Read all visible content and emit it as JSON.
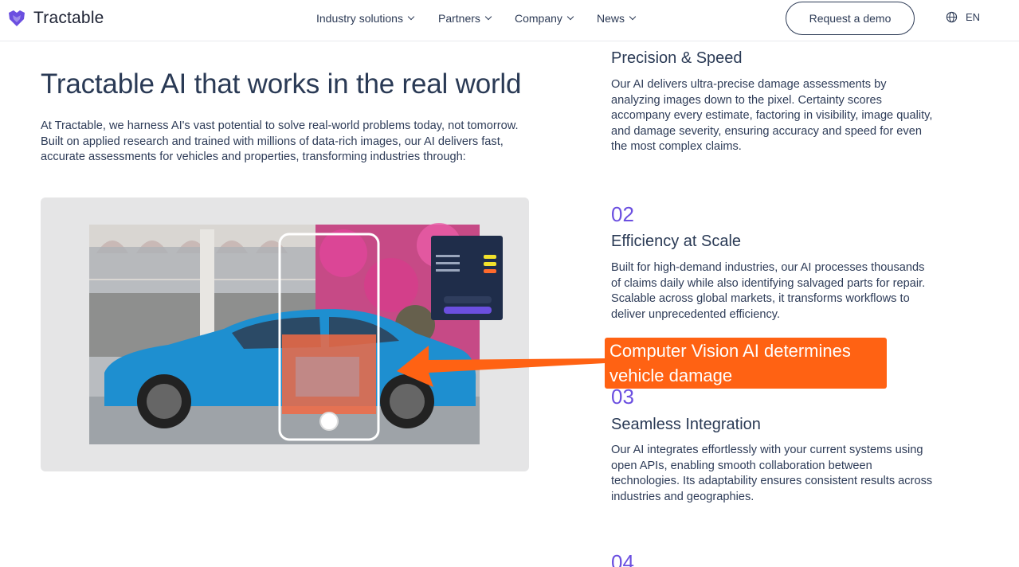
{
  "header": {
    "brand": "Tractable",
    "nav": [
      {
        "label": "Industry solutions"
      },
      {
        "label": "Partners"
      },
      {
        "label": "Company"
      },
      {
        "label": "News"
      }
    ],
    "cta_label": "Request a demo",
    "language": "EN"
  },
  "hero": {
    "title": "Tractable AI that works in the real world",
    "body": "At Tractable, we harness AI's vast potential to solve real-world problems today, not tomorrow. Built on applied research and trained with millions of data-rich images, our AI delivers fast, accurate assessments for vehicles and properties, transforming industries through:"
  },
  "features": [
    {
      "title": "Precision & Speed",
      "body": "Our AI delivers ultra-precise damage assessments by analyzing images down to the pixel. Certainty scores accompany every estimate, factoring in visibility, image quality, and damage severity, ensuring accuracy and speed for even the most complex claims."
    },
    {
      "number": "02",
      "title": "Efficiency at Scale",
      "body": "Built for high-demand industries, our AI processes thousands of claims daily while also identifying salvaged parts for repair. Scalable across global markets, it transforms workflows to deliver unprecedented efficiency."
    },
    {
      "number": "03",
      "title": "Seamless Integration",
      "body": "Our AI integrates effortlessly with your current systems using open APIs, enabling smooth collaboration between technologies. Its adaptability ensures consistent results across industries and geographies."
    },
    {
      "number": "04"
    }
  ],
  "annotation": {
    "text": "Computer Vision AI determines vehicle damage"
  },
  "colors": {
    "accent": "#6b4fe0",
    "callout": "#ff6213",
    "car": "#1e8fd0"
  }
}
